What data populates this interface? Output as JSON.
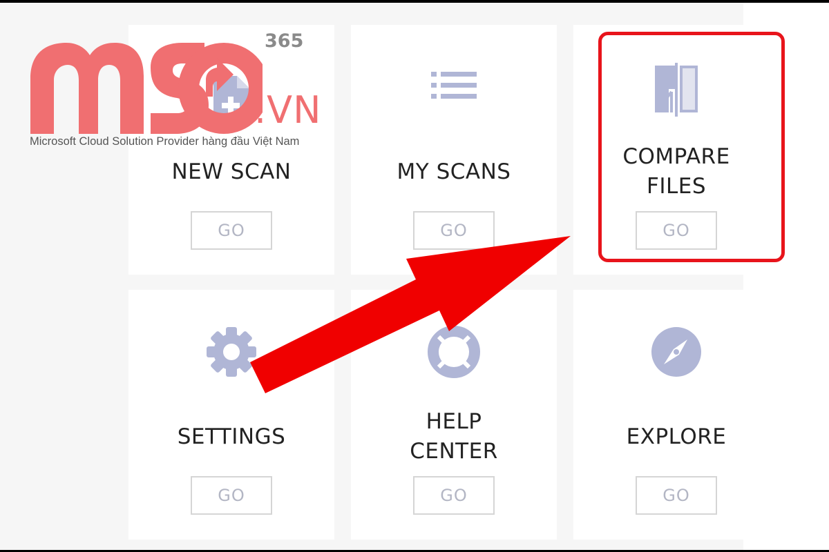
{
  "logo": {
    "brand": "MSO",
    "badge": "365",
    "domain": ".VN",
    "tagline": "Microsoft Cloud Solution Provider hàng đầu Việt Nam",
    "color": "#f06f71"
  },
  "colors": {
    "icon": "#b0b6d6",
    "highlight": "#e8141b",
    "arrow": "#f00000",
    "button_text": "#b3b6c4"
  },
  "cards": [
    {
      "id": "new-scan",
      "title_lines": [
        "NEW SCAN"
      ],
      "icon": "new-document-icon",
      "button_label": "GO"
    },
    {
      "id": "my-scans",
      "title_lines": [
        "MY SCANS"
      ],
      "icon": "list-icon",
      "button_label": "GO"
    },
    {
      "id": "compare-files",
      "title_lines": [
        "COMPARE",
        "FILES"
      ],
      "icon": "compare-files-icon",
      "button_label": "GO",
      "highlighted": true
    },
    {
      "id": "settings",
      "title_lines": [
        "SETTINGS"
      ],
      "icon": "gear-icon",
      "button_label": "GO"
    },
    {
      "id": "help-center",
      "title_lines": [
        "HELP",
        "CENTER"
      ],
      "icon": "lifebuoy-icon",
      "button_label": "GO"
    },
    {
      "id": "explore",
      "title_lines": [
        "EXPLORE"
      ],
      "icon": "compass-icon",
      "button_label": "GO"
    }
  ],
  "annotation": {
    "type": "arrow",
    "points_to": "compare-files"
  }
}
